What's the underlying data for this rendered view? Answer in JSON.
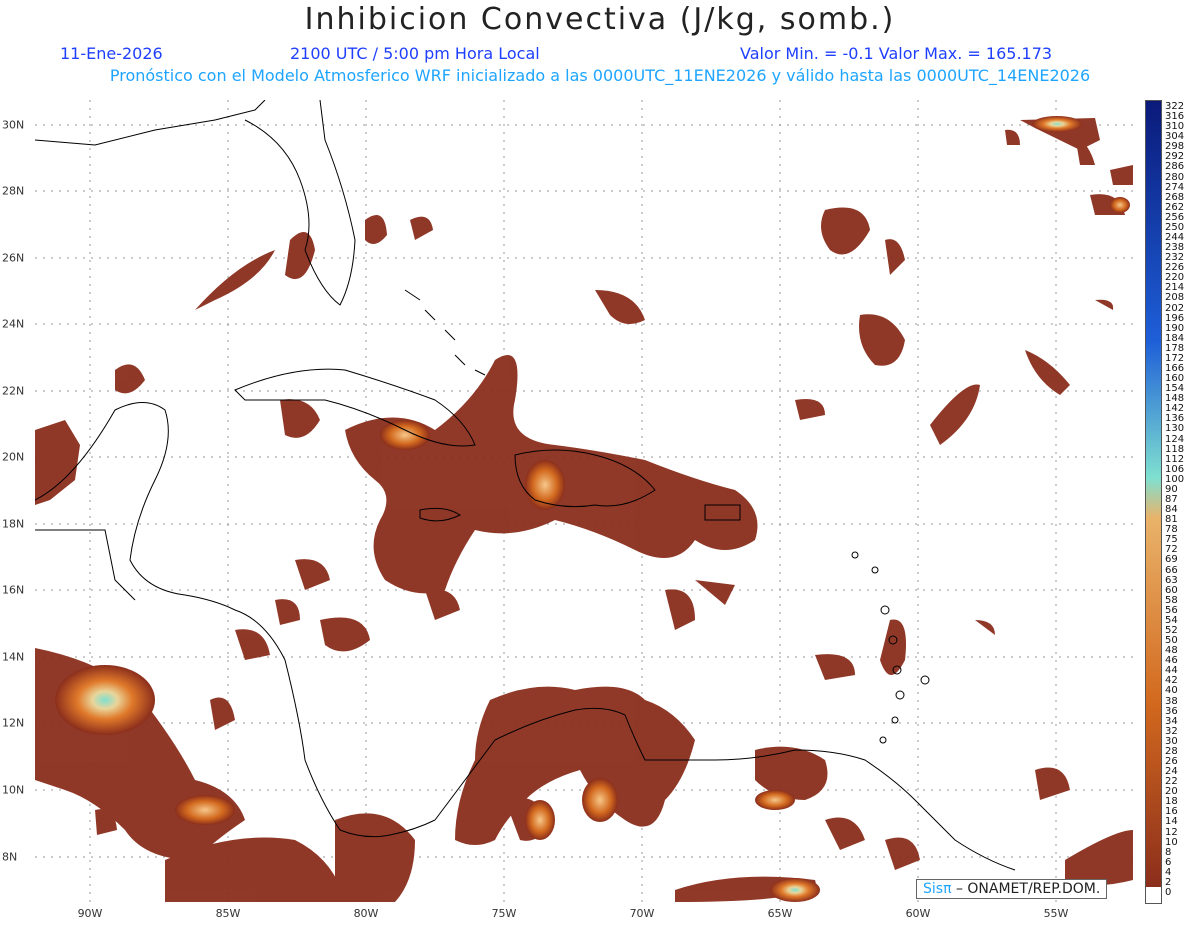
{
  "header": {
    "title": "Inhibicion Convectiva (J/kg, somb.)",
    "date": "11-Ene-2026",
    "time": "2100 UTC / 5:00 pm Hora Local",
    "minmax": "Valor Min. = -0.1  Valor Max. = 165.173",
    "forecast_note": "Pronóstico con el Modelo Atmosferico WRF inicializado a las 0000UTC_11ENE2026 y válido hasta las  0000UTC_14ENE2026"
  },
  "axes": {
    "lon_labels": [
      "90W",
      "85W",
      "80W",
      "75W",
      "70W",
      "65W",
      "60W",
      "55W"
    ],
    "lat_labels": [
      "30N",
      "28N",
      "26N",
      "24N",
      "22N",
      "20N",
      "18N",
      "16N",
      "14N",
      "12N",
      "10N",
      "8N"
    ]
  },
  "colorbar": {
    "labels": [
      "322",
      "316",
      "310",
      "304",
      "298",
      "292",
      "286",
      "280",
      "274",
      "268",
      "262",
      "256",
      "250",
      "244",
      "238",
      "232",
      "226",
      "220",
      "214",
      "208",
      "202",
      "196",
      "190",
      "184",
      "178",
      "172",
      "166",
      "160",
      "154",
      "148",
      "142",
      "136",
      "130",
      "124",
      "118",
      "112",
      "106",
      "100",
      "90",
      "87",
      "84",
      "81",
      "78",
      "75",
      "72",
      "69",
      "66",
      "63",
      "60",
      "58",
      "56",
      "54",
      "52",
      "50",
      "48",
      "46",
      "44",
      "42",
      "40",
      "38",
      "36",
      "34",
      "32",
      "30",
      "28",
      "26",
      "24",
      "22",
      "20",
      "18",
      "16",
      "14",
      "12",
      "10",
      "8",
      "6",
      "4",
      "2",
      "0"
    ],
    "colors": {
      "low": "#8b2e1c",
      "mid": "#d2691e",
      "high": "#e9b36a",
      "cyan": "#7fe0d0",
      "blue": "#1e5fd8",
      "navy": "#0a1a7a"
    }
  },
  "credit": {
    "logo_text": "Sisπ",
    "text": "– ONAMET/REP.DOM."
  }
}
